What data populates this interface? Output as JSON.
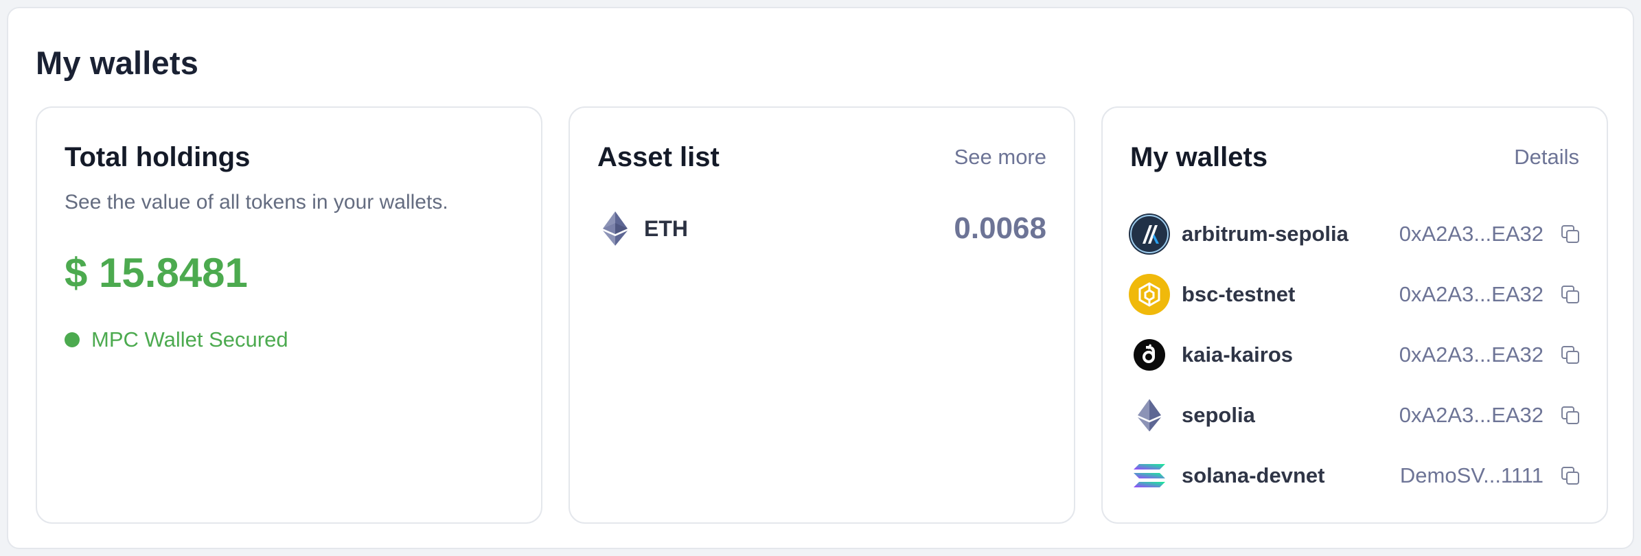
{
  "page": {
    "title": "My wallets"
  },
  "holdings": {
    "title": "Total holdings",
    "subtitle": "See the value of all tokens in your wallets.",
    "total": "$ 15.8481",
    "status": "MPC Wallet Secured",
    "status_color": "#4caa4f"
  },
  "assets": {
    "title": "Asset list",
    "link": "See more",
    "items": [
      {
        "icon": "ethereum-icon",
        "symbol": "ETH",
        "amount": "0.0068"
      }
    ]
  },
  "wallets": {
    "title": "My wallets",
    "link": "Details",
    "items": [
      {
        "icon": "arbitrum-icon",
        "name": "arbitrum-sepolia",
        "address": "0xA2A3...EA32"
      },
      {
        "icon": "bnb-icon",
        "name": "bsc-testnet",
        "address": "0xA2A3...EA32"
      },
      {
        "icon": "kaia-icon",
        "name": "kaia-kairos",
        "address": "0xA2A3...EA32"
      },
      {
        "icon": "ethereum-icon",
        "name": "sepolia",
        "address": "0xA2A3...EA32"
      },
      {
        "icon": "solana-icon",
        "name": "solana-devnet",
        "address": "DemoSV...1111"
      }
    ]
  },
  "colors": {
    "accent_green": "#4caa4f",
    "muted_link": "#6d7496",
    "bnb_gold": "#f0b90b",
    "arbitrum_dark": "#213147",
    "arbitrum_blue": "#28a0f0"
  }
}
